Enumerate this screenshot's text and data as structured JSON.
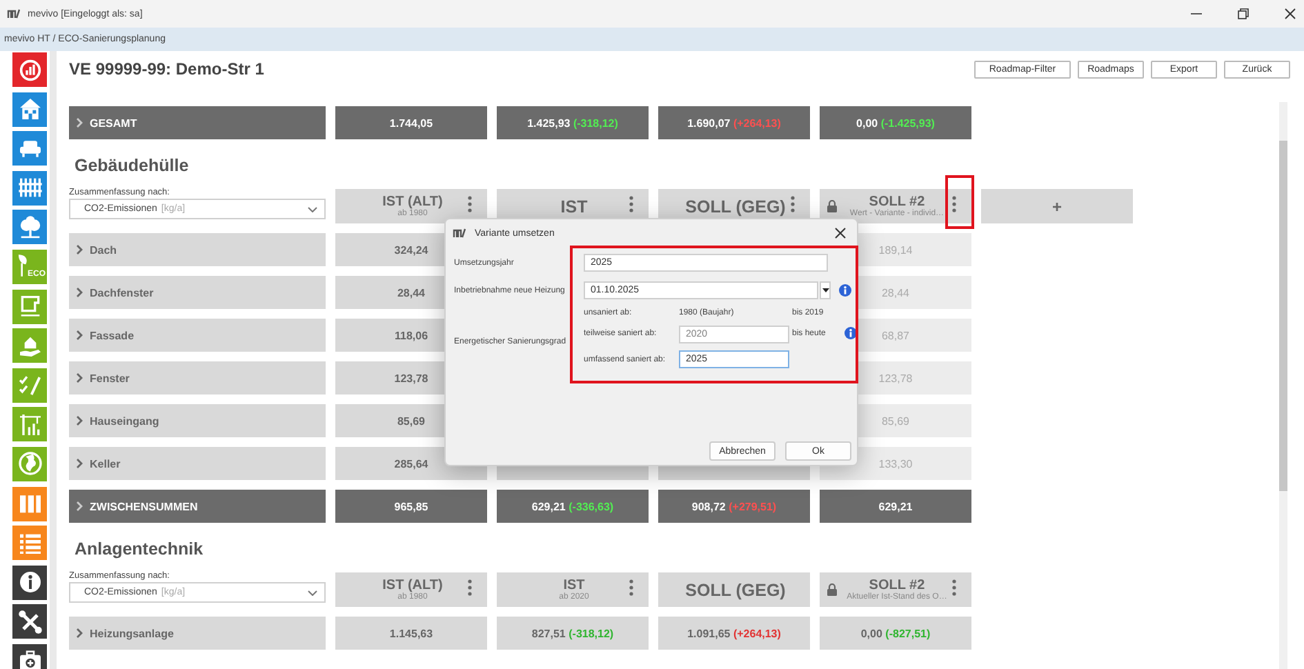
{
  "window": {
    "title": "mevivo [Eingeloggt als: sa]"
  },
  "breadcrumb": "mevivo HT / ECO-Sanierungsplanung",
  "sidebar": {
    "items": [
      {
        "kind": "chart",
        "color": "#e3262b"
      },
      {
        "kind": "house",
        "color": "#1f8ad8"
      },
      {
        "kind": "sofa",
        "color": "#1f8ad8"
      },
      {
        "kind": "fence",
        "color": "#1f8ad8"
      },
      {
        "kind": "tree",
        "color": "#1f8ad8"
      },
      {
        "kind": "eco",
        "color": "#7ab51d",
        "text": "ECO"
      },
      {
        "kind": "plan",
        "color": "#7ab51d"
      },
      {
        "kind": "househand",
        "color": "#7ab51d"
      },
      {
        "kind": "checkpen",
        "color": "#7ab51d"
      },
      {
        "kind": "crane",
        "color": "#7ab51d"
      },
      {
        "kind": "globe",
        "color": "#7ab51d"
      },
      {
        "kind": "columns",
        "color": "#f7861c"
      },
      {
        "kind": "list",
        "color": "#f7861c"
      },
      {
        "kind": "info",
        "color": "#3c3c3c"
      },
      {
        "kind": "tools",
        "color": "#3c3c3c"
      },
      {
        "kind": "firstaid",
        "color": "#3c3c3c"
      }
    ]
  },
  "page": {
    "title": "VE 99999-99: Demo-Str 1",
    "buttons": [
      "Roadmap-Filter",
      "Roadmaps",
      "Export",
      "Zurück"
    ]
  },
  "total_row": {
    "label": "GESAMT",
    "cells": [
      {
        "value": "1.744,05"
      },
      {
        "value": "1.425,93",
        "delta": "(-318,12)",
        "color": "#52ee52"
      },
      {
        "value": "1.690,07",
        "delta": "(+264,13)",
        "color": "#ff5050"
      },
      {
        "value": "0,00",
        "delta": "(-1.425,93)",
        "color": "#52ee52"
      }
    ]
  },
  "sections": [
    {
      "title": "Gebäudehülle",
      "summary_label": "Zusammenfassung nach:",
      "summary_select": {
        "value": "CO2-Emissionen",
        "unit": "[kg/a]"
      },
      "columns": [
        {
          "kind": "variant",
          "title": "IST (ALT)",
          "subtitle": "ab 1980",
          "locked": false,
          "menu": true,
          "highlight": false,
          "dimmed": false
        },
        {
          "kind": "variant",
          "title": "IST",
          "locked": false,
          "menu": true,
          "highlight": false,
          "dimmed": false
        },
        {
          "kind": "variant",
          "title": "SOLL (GEG)",
          "locked": false,
          "menu": true,
          "highlight": false,
          "dimmed": false
        },
        {
          "kind": "variant",
          "title": "SOLL #2",
          "subtitle": "Wert - Variante - individ…",
          "locked": true,
          "menu": true,
          "highlight": true,
          "dimmed": true
        },
        {
          "kind": "add",
          "label": "+"
        }
      ],
      "rows": [
        {
          "kind": "item",
          "label": "Dach",
          "cells": [
            {
              "value": "324,24"
            },
            null,
            null,
            {
              "value": "189,14"
            }
          ]
        },
        {
          "kind": "item",
          "label": "Dachfenster",
          "cells": [
            {
              "value": "28,44"
            },
            null,
            null,
            {
              "value": "28,44"
            }
          ]
        },
        {
          "kind": "item",
          "label": "Fassade",
          "cells": [
            {
              "value": "118,06"
            },
            null,
            null,
            {
              "value": "68,87"
            }
          ]
        },
        {
          "kind": "item",
          "label": "Fenster",
          "cells": [
            {
              "value": "123,78"
            },
            null,
            null,
            {
              "value": "123,78"
            }
          ]
        },
        {
          "kind": "item",
          "label": "Hauseingang",
          "cells": [
            {
              "value": "85,69"
            },
            null,
            null,
            {
              "value": "85,69"
            }
          ]
        },
        {
          "kind": "item",
          "label": "Keller",
          "cells": [
            {
              "value": "285,64"
            },
            null,
            null,
            {
              "value": "133,30"
            }
          ]
        },
        {
          "kind": "subtotal",
          "label": "ZWISCHENSUMMEN",
          "cells": [
            {
              "value": "965,85"
            },
            {
              "value": "629,21",
              "delta": "(-336,63)",
              "color": "#52ee52"
            },
            {
              "value": "908,72",
              "delta": "(+279,51)",
              "color": "#ff5050"
            },
            {
              "value": "629,21"
            }
          ]
        }
      ]
    },
    {
      "title": "Anlagentechnik",
      "summary_label": "Zusammenfassung nach:",
      "summary_select": {
        "value": "CO2-Emissionen",
        "unit": "[kg/a]"
      },
      "columns": [
        {
          "kind": "variant",
          "title": "IST (ALT)",
          "subtitle": "ab 1980",
          "locked": false,
          "menu": true,
          "highlight": false,
          "dimmed": false
        },
        {
          "kind": "variant",
          "title": "IST",
          "subtitle": "ab 2020",
          "locked": false,
          "menu": true,
          "highlight": false,
          "dimmed": false
        },
        {
          "kind": "variant",
          "title": "SOLL (GEG)",
          "locked": false,
          "menu": false,
          "highlight": false,
          "dimmed": false
        },
        {
          "kind": "variant",
          "title": "SOLL #2",
          "subtitle": "Aktueller Ist-Stand des O…",
          "locked": true,
          "menu": true,
          "highlight": false,
          "dimmed": false
        }
      ],
      "rows": [
        {
          "kind": "item",
          "label": "Heizungsanlage",
          "cells": [
            {
              "value": "1.145,63"
            },
            {
              "value": "827,51",
              "delta": "(-318,12)",
              "color": "#2fb52f"
            },
            {
              "value": "1.091,65",
              "delta": "(+264,13)",
              "color": "#e23232"
            },
            {
              "value": "0,00",
              "delta": "(-827,51)",
              "color": "#2fb52f"
            }
          ]
        }
      ]
    }
  ],
  "dialog": {
    "title": "Variante umsetzen",
    "highlight": true,
    "fields": [
      {
        "kind": "text",
        "label": "Umsetzungsjahr",
        "value": "2025"
      },
      {
        "kind": "dropdown",
        "label": "Inbetriebnahme neue Heizung",
        "value": "01.10.2025",
        "info": true
      },
      {
        "kind": "grade",
        "label": "Energetischer Sanierungsgrad",
        "levels": [
          {
            "kind": "fixed",
            "label": "unsaniert ab:",
            "value": "1980 (Baujahr)",
            "until": "bis 2019",
            "info": false
          },
          {
            "kind": "input",
            "label": "teilweise saniert ab:",
            "value": "2020",
            "until": "bis heute",
            "info": true,
            "disabled": true,
            "focused": false
          },
          {
            "kind": "input",
            "label": "umfassend saniert ab:",
            "value": "2025",
            "info": false,
            "disabled": false,
            "focused": true
          }
        ]
      }
    ],
    "buttons": [
      "Abbrechen",
      "Ok"
    ]
  }
}
